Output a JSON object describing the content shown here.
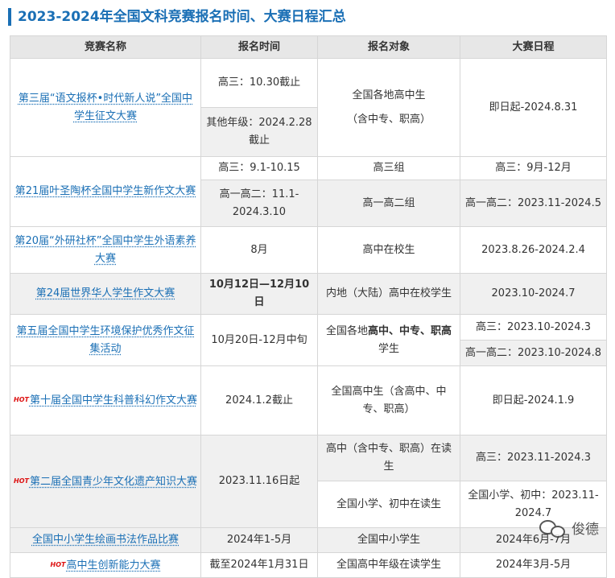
{
  "title": "2023-2024年全国文科竞赛报名时间、大赛日程汇总",
  "headers": [
    "竞赛名称",
    "报名时间",
    "报名对象",
    "大赛日程"
  ],
  "hot_badge": "HOT",
  "rows": {
    "r1": {
      "name": "第三届“语文报杯•时代新人说”全国中学生征文大赛",
      "time1": "高三：10.30截止",
      "time2": "其他年级：2024.2.28截止",
      "target": "全国各地高中生",
      "target_note": "（含中专、职高）",
      "schedule": "即日起-2024.8.31"
    },
    "r2": {
      "name": "第21届叶圣陶杯全国中学生新作文大赛",
      "time1": "高三：9.1-10.15",
      "target1": "高三组",
      "schedule1": "高三：9月-12月",
      "time2": "高一高二：11.1-2024.3.10",
      "target2": "高一高二组",
      "schedule2": "高一高二：2023.11-2024.5"
    },
    "r3": {
      "name": "第20届“外研社杯”全国中学生外语素养大赛",
      "time": "8月",
      "target": "高中在校生",
      "schedule": "2023.8.26-2024.2.4"
    },
    "r4": {
      "name": "第24届世界华人学生作文大赛",
      "time": "10月12日—12月10日",
      "target": "内地（大陆）高中在校学生",
      "schedule": "2023.10-2024.7"
    },
    "r5": {
      "name": "第五届全国中学生环境保护优秀作文征集活动",
      "time": "10月20日-12月中旬",
      "target_pre": "全国各地",
      "target_bold": "高中、中专、职高",
      "target_post": "学生",
      "schedule1": "高三：2023.10-2024.3",
      "schedule2": "高一高二：2023.10-2024.8"
    },
    "r6": {
      "name": "第十届全国中学生科普科幻作文大赛",
      "time": "2024.1.2截止",
      "target": "全国高中生（含高中、中专、职高）",
      "schedule": "即日起-2024.1.9"
    },
    "r7": {
      "name": "第二届全国青少年文化遗产知识大赛",
      "time": "2023.11.16日起",
      "target1": "高中（含中专、职高）在读生",
      "schedule1": "高三：2023.11-2024.3",
      "target2": "全国小学、初中在读生",
      "schedule2": "全国小学、初中：2023.11-2024.7"
    },
    "r8": {
      "name": "全国中小学生绘画书法作品比赛",
      "time": "2024年1-5月",
      "target": "全国中小学生",
      "schedule": "2024年6月-7月"
    },
    "r9": {
      "name": "高中生创新能力大赛",
      "time": "截至2024年1月31日",
      "target": "全国高中年级在读学生",
      "schedule": "2024年3月-5月"
    }
  },
  "watermark": "俊德",
  "colors": {
    "accent": "#1a6fb5",
    "hot": "#dd1111",
    "header_bg": "#e7e7e7",
    "alt_bg": "#f0f0f0"
  }
}
